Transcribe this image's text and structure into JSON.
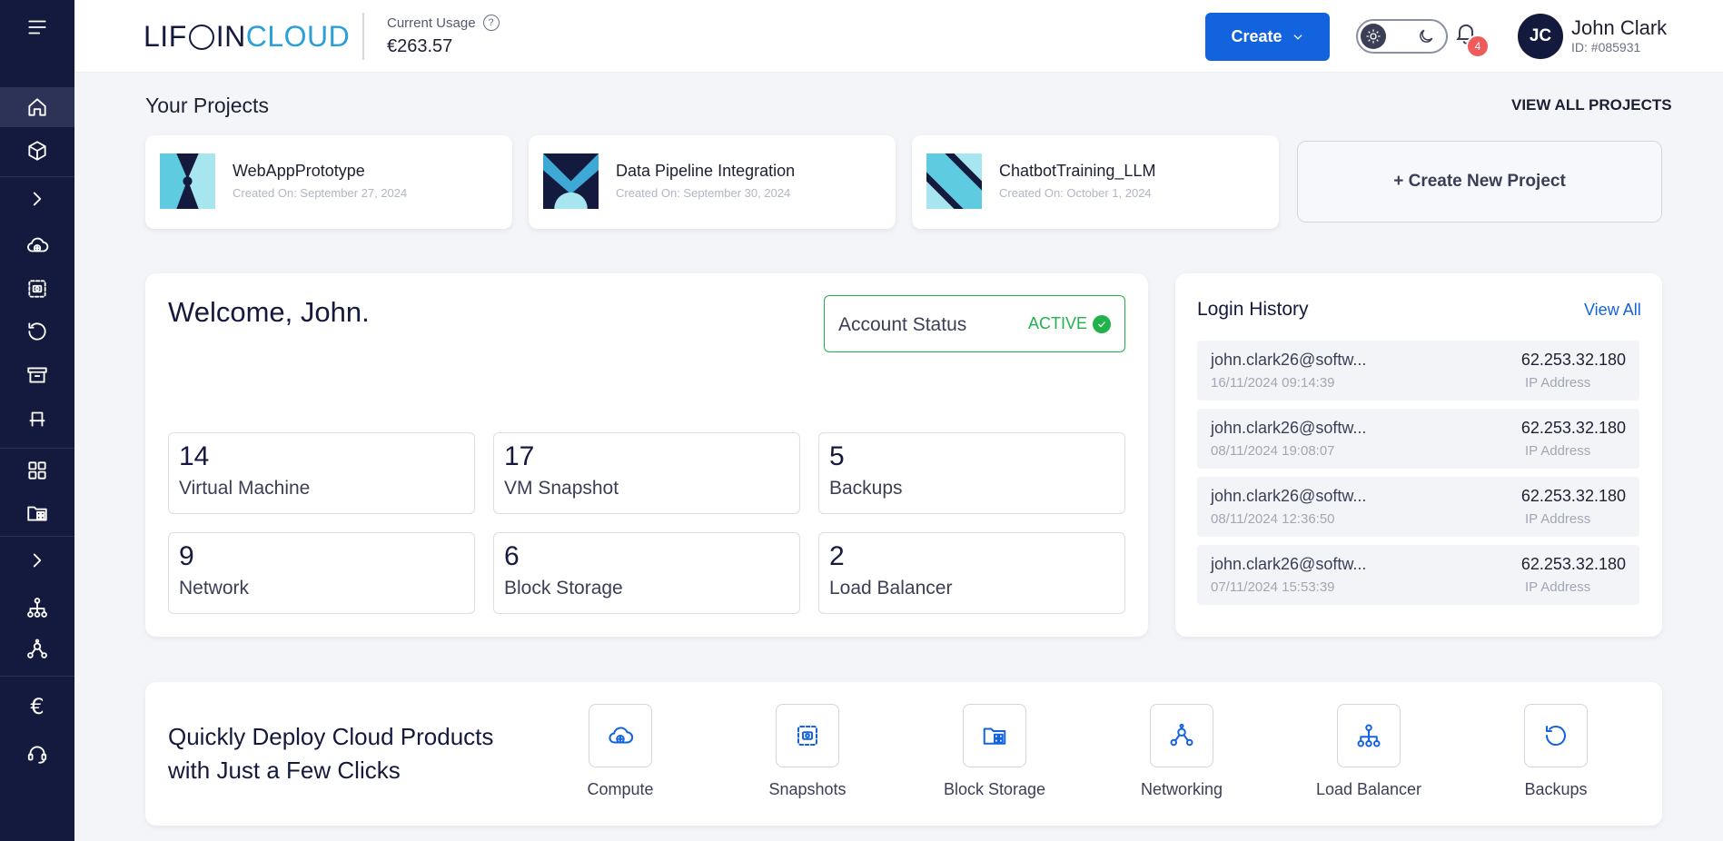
{
  "header": {
    "logo_left": "LIF",
    "logo_mid": "IN",
    "logo_right": "CLOUD",
    "usage_label": "Current Usage",
    "usage_value": "€263.57",
    "create_label": "Create",
    "notification_count": "4",
    "user_initials": "JC",
    "user_name": "John Clark",
    "user_id": "ID: #085931"
  },
  "sidebar": {
    "icons": [
      "menu-icon",
      "home-icon",
      "cube-icon",
      "chevron-right-icon",
      "cloud-plus-icon",
      "snapshot-icon",
      "backup-icon",
      "archive-icon",
      "bench-icon",
      "grid-icon",
      "block-storage-icon",
      "chevron-right-icon",
      "load-balancer-icon",
      "network-icon",
      "euro-icon",
      "headset-icon"
    ],
    "euro_glyph": "€"
  },
  "projects": {
    "title": "Your Projects",
    "view_all": "VIEW ALL PROJECTS",
    "items": [
      {
        "name": "WebAppPrototype",
        "date": "Created On: September 27, 2024"
      },
      {
        "name": "Data Pipeline Integration",
        "date": "Created On: September 30, 2024"
      },
      {
        "name": "ChatbotTraining_LLM",
        "date": "Created On: October 1, 2024"
      }
    ],
    "new_project": "+ Create New Project"
  },
  "welcome": {
    "title": "Welcome, John.",
    "account_status_label": "Account Status",
    "account_status_value": "ACTIVE",
    "stats": [
      {
        "value": "14",
        "label": "Virtual Machine"
      },
      {
        "value": "17",
        "label": "VM Snapshot"
      },
      {
        "value": "5",
        "label": "Backups"
      },
      {
        "value": "9",
        "label": "Network"
      },
      {
        "value": "6",
        "label": "Block Storage"
      },
      {
        "value": "2",
        "label": "Load Balancer"
      }
    ]
  },
  "login_history": {
    "title": "Login History",
    "view_all": "View All",
    "ip_label": "IP Address",
    "rows": [
      {
        "email": "john.clark26@softw...",
        "time": "16/11/2024 09:14:39",
        "ip": "62.253.32.180"
      },
      {
        "email": "john.clark26@softw...",
        "time": "08/11/2024 19:08:07",
        "ip": "62.253.32.180"
      },
      {
        "email": "john.clark26@softw...",
        "time": "08/11/2024 12:36:50",
        "ip": "62.253.32.180"
      },
      {
        "email": "john.clark26@softw...",
        "time": "07/11/2024 15:53:39",
        "ip": "62.253.32.180"
      }
    ]
  },
  "quick_deploy": {
    "title": "Quickly Deploy Cloud Products with Just a Few Clicks",
    "items": [
      {
        "label": "Compute",
        "icon": "cloud-plus-icon"
      },
      {
        "label": "Snapshots",
        "icon": "snapshot-icon"
      },
      {
        "label": "Block Storage",
        "icon": "block-storage-icon"
      },
      {
        "label": "Networking",
        "icon": "network-icon"
      },
      {
        "label": "Load Balancer",
        "icon": "load-balancer-icon"
      },
      {
        "label": "Backups",
        "icon": "backup-icon"
      }
    ]
  },
  "colors": {
    "sidebar": "#141a3d",
    "accent": "#1363df",
    "active_green": "#21b24b",
    "badge_red": "#f05a5a",
    "logo_blue": "#2a9fd8"
  }
}
